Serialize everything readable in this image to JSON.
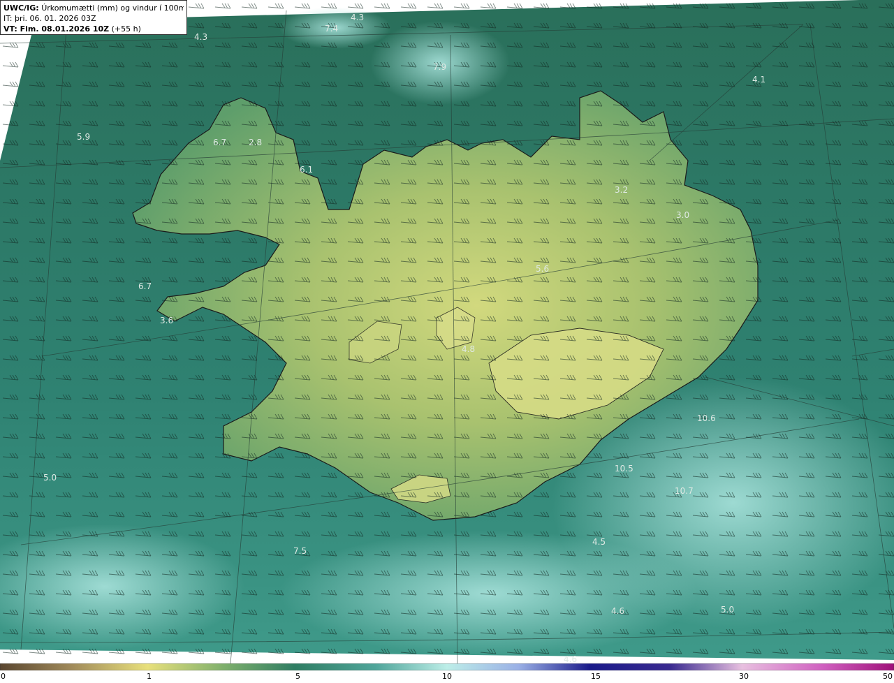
{
  "header": {
    "title_prefix": "UWC/IG:",
    "title_text": "Úrkomumætti (mm) og vindur í 100m hæð",
    "issue_time": "IT: þri. 06. 01. 2026 03Z",
    "valid_prefix": "VT: Fim. 08.01.2026 10Z",
    "valid_suffix": "(+55 h)"
  },
  "colors": {
    "ocean_dark": "#1f6a5a",
    "ocean_mid": "#2f7f6a",
    "land_low": "#4f9a6a",
    "land_high": "#c9d37c",
    "light_cyan": "#9fdcd6"
  },
  "values": [
    {
      "label": "4.3"
    },
    {
      "label": "7.4"
    },
    {
      "label": "4.3"
    },
    {
      "label": "7.9"
    },
    {
      "label": "4.1"
    },
    {
      "label": "5.9"
    },
    {
      "label": "6.7"
    },
    {
      "label": "2.8"
    },
    {
      "label": "6.1"
    },
    {
      "label": "3.2"
    },
    {
      "label": "3.0"
    },
    {
      "label": "5.6"
    },
    {
      "label": "6.7"
    },
    {
      "label": "3.6"
    },
    {
      "label": "4.8"
    },
    {
      "label": "10.6"
    },
    {
      "label": "5.0"
    },
    {
      "label": "10.5"
    },
    {
      "label": "10.7"
    },
    {
      "label": "4.5"
    },
    {
      "label": "7.5"
    },
    {
      "label": "4.6"
    },
    {
      "label": "5.0"
    },
    {
      "label": "4.6"
    }
  ],
  "colorbar": {
    "ticks": [
      "0",
      "1",
      "5",
      "10",
      "15",
      "30",
      "50"
    ]
  }
}
